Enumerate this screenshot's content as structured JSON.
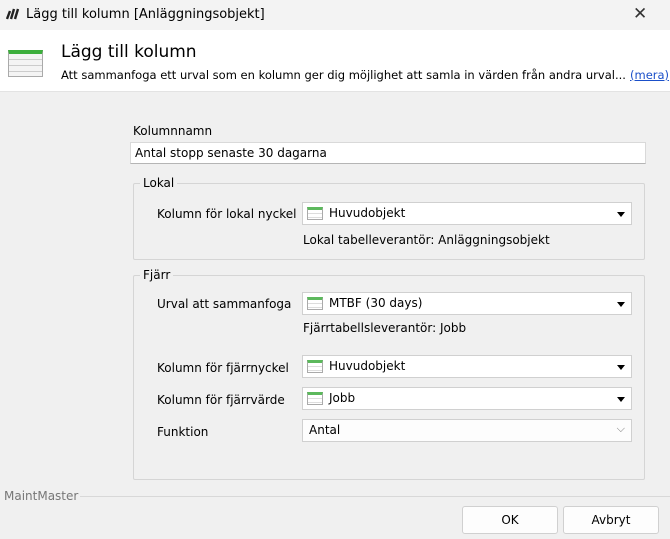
{
  "window": {
    "title": "Lägg till kolumn [Anläggningsobjekt]",
    "close_icon": "close-icon"
  },
  "header": {
    "title": "Lägg till kolumn",
    "description": "Att sammanfoga ett urval som en kolumn ger dig möjlighet att samla in värden från andra urval...",
    "more_link": "(mera)"
  },
  "form": {
    "column_name_label": "Kolumnnamn",
    "column_name_value": "Antal stopp senaste 30 dagarna",
    "local": {
      "title": "Lokal",
      "key_label": "Kolumn för lokal nyckel",
      "key_value": "Huvudobjekt",
      "provider": "Lokal tabelleverantör: Anläggningsobjekt"
    },
    "remote": {
      "title": "Fjärr",
      "selection_label": "Urval att sammanfoga",
      "selection_value": "MTBF (30 days)",
      "provider": "Fjärrtabellsleverantör: Jobb",
      "key_label": "Kolumn för fjärrnyckel",
      "key_value": "Huvudobjekt",
      "value_label": "Kolumn för fjärrvärde",
      "value_value": "Jobb",
      "function_label": "Funktion",
      "function_value": "Antal"
    }
  },
  "footer": {
    "brand": "MaintMaster",
    "ok": "OK",
    "cancel": "Avbryt"
  }
}
